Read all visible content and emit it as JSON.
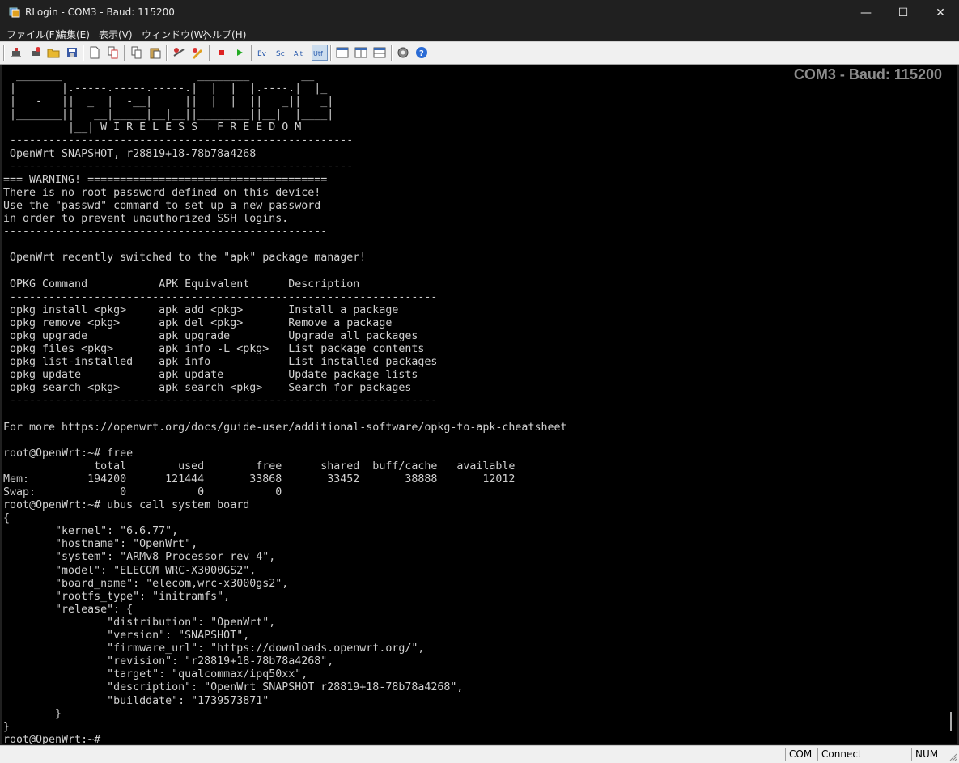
{
  "window": {
    "title": "RLogin - COM3 - Baud: 115200",
    "minimize_glyph": "—",
    "maximize_glyph": "☐",
    "close_glyph": "✕"
  },
  "menu": [
    {
      "label": "ファイル(F)"
    },
    {
      "label": "編集(E)"
    },
    {
      "label": "表示(V)"
    },
    {
      "label": "ウィンドウ(W)"
    },
    {
      "label": "ヘルプ(H)"
    }
  ],
  "toolbar": {
    "icons": [
      "new-connection-icon",
      "reconnect-icon",
      "open-folder-icon",
      "save-icon",
      "new-document-icon",
      "copy-document-icon",
      "copy-icon",
      "paste-icon",
      "send-file-icon",
      "script-icon",
      "stop-icon",
      "play-icon",
      "event-icon",
      "screen-icon",
      "alt-icon",
      "utf-icon",
      "window-single-icon",
      "window-split-icon",
      "window-tile-icon",
      "settings-icon",
      "help-icon"
    ]
  },
  "terminal": {
    "overlay": "COM3 - Baud: 115200",
    "lines": [
      "  _______                     ________        __",
      " |       |.-----.-----.-----.|  |  |  |.----.|  |_",
      " |   -   ||  _  |  -__|     ||  |  |  ||   _||   _|",
      " |_______||   __|_____|__|__||________||__|  |____|",
      "          |__| W I R E L E S S   F R E E D O M",
      " -----------------------------------------------------",
      " OpenWrt SNAPSHOT, r28819+18-78b78a4268",
      " -----------------------------------------------------",
      "=== WARNING! =====================================",
      "There is no root password defined on this device!",
      "Use the \"passwd\" command to set up a new password",
      "in order to prevent unauthorized SSH logins.",
      "--------------------------------------------------",
      "",
      " OpenWrt recently switched to the \"apk\" package manager!",
      "",
      " OPKG Command           APK Equivalent      Description",
      " ------------------------------------------------------------------",
      " opkg install <pkg>     apk add <pkg>       Install a package",
      " opkg remove <pkg>      apk del <pkg>       Remove a package",
      " opkg upgrade           apk upgrade         Upgrade all packages",
      " opkg files <pkg>       apk info -L <pkg>   List package contents",
      " opkg list-installed    apk info            List installed packages",
      " opkg update            apk update          Update package lists",
      " opkg search <pkg>      apk search <pkg>    Search for packages",
      " ------------------------------------------------------------------",
      "",
      "For more https://openwrt.org/docs/guide-user/additional-software/opkg-to-apk-cheatsheet",
      "",
      "root@OpenWrt:~# free",
      "              total        used        free      shared  buff/cache   available",
      "Mem:         194200      121444       33868       33452       38888       12012",
      "Swap:             0           0           0",
      "root@OpenWrt:~# ubus call system board",
      "{",
      "        \"kernel\": \"6.6.77\",",
      "        \"hostname\": \"OpenWrt\",",
      "        \"system\": \"ARMv8 Processor rev 4\",",
      "        \"model\": \"ELECOM WRC-X3000GS2\",",
      "        \"board_name\": \"elecom,wrc-x3000gs2\",",
      "        \"rootfs_type\": \"initramfs\",",
      "        \"release\": {",
      "                \"distribution\": \"OpenWrt\",",
      "                \"version\": \"SNAPSHOT\",",
      "                \"firmware_url\": \"https://downloads.openwrt.org/\",",
      "                \"revision\": \"r28819+18-78b78a4268\",",
      "                \"target\": \"qualcommax/ipq50xx\",",
      "                \"description\": \"OpenWrt SNAPSHOT r28819+18-78b78a4268\",",
      "                \"builddate\": \"1739573871\"",
      "        }",
      "}",
      "root@OpenWrt:~#"
    ]
  },
  "statusbar": {
    "com": "COM",
    "connect": "Connect",
    "num": "NUM"
  }
}
